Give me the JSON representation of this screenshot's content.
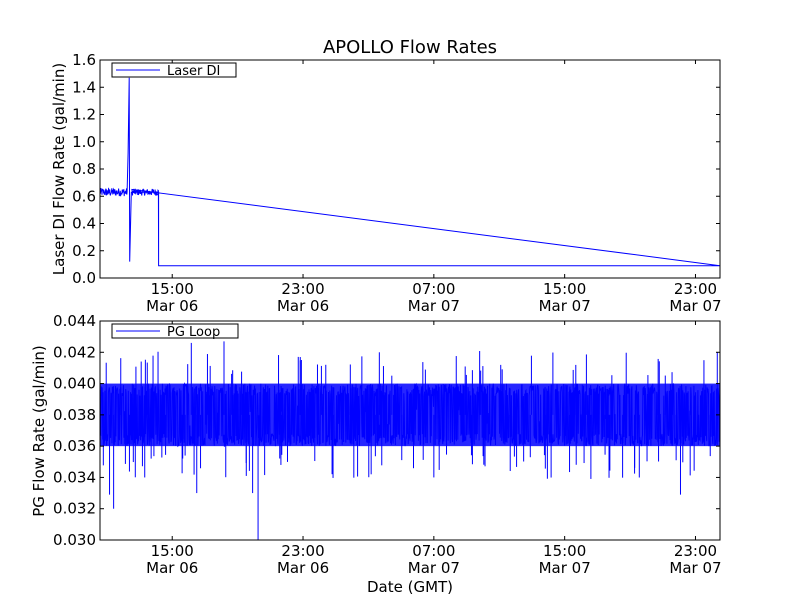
{
  "figure": {
    "title": "APOLLO Flow Rates",
    "xlabel": "Date (GMT)"
  },
  "chart_data": [
    {
      "type": "line",
      "ylabel": "Laser DI Flow Rate (gal/min)",
      "ylim": [
        0.0,
        1.6
      ],
      "yticks": [
        "0.0",
        "0.2",
        "0.4",
        "0.6",
        "0.8",
        "1.0",
        "1.2",
        "1.4",
        "1.6"
      ],
      "xlim": [
        "Mar 06 10:35",
        "Mar 08 00:30"
      ],
      "xticks": [
        {
          "time": "15:00",
          "date": "Mar 06"
        },
        {
          "time": "23:00",
          "date": "Mar 06"
        },
        {
          "time": "07:00",
          "date": "Mar 07"
        },
        {
          "time": "15:00",
          "date": "Mar 07"
        },
        {
          "time": "23:00",
          "date": "Mar 07"
        }
      ],
      "legend": {
        "label": "Laser DI",
        "position": "top-left"
      },
      "grid": false,
      "color": "#0000ff",
      "series": [
        {
          "name": "Laser DI",
          "approx_points": [
            {
              "t": "Mar 06 10:35",
              "y": 0.63
            },
            {
              "t": "Mar 06 11:30",
              "y": 0.64
            },
            {
              "t": "Mar 06 12:20",
              "y": 0.62
            },
            {
              "t": "Mar 06 12:18",
              "y": 0.92
            },
            {
              "t": "Mar 06 12:22",
              "y": 1.47
            },
            {
              "t": "Mar 06 12:24",
              "y": 0.12
            },
            {
              "t": "Mar 06 12:30",
              "y": 0.63
            },
            {
              "t": "Mar 06 14:10",
              "y": 0.63
            },
            {
              "t": "Mar 06 14:10",
              "y": 0.09
            },
            {
              "t": "Mar 08 00:30",
              "y": 0.09
            }
          ]
        }
      ]
    },
    {
      "type": "line",
      "ylabel": "PG Flow Rate (gal/min)",
      "ylim": [
        0.03,
        0.044
      ],
      "yticks": [
        "0.030",
        "0.032",
        "0.034",
        "0.036",
        "0.038",
        "0.040",
        "0.042",
        "0.044"
      ],
      "xlim": [
        "Mar 06 10:35",
        "Mar 08 00:30"
      ],
      "xticks": [
        {
          "time": "15:00",
          "date": "Mar 06"
        },
        {
          "time": "23:00",
          "date": "Mar 06"
        },
        {
          "time": "07:00",
          "date": "Mar 07"
        },
        {
          "time": "15:00",
          "date": "Mar 07"
        },
        {
          "time": "23:00",
          "date": "Mar 07"
        }
      ],
      "legend": {
        "label": "PG Loop",
        "position": "top-left"
      },
      "grid": false,
      "color": "#0000ff",
      "series": [
        {
          "name": "PG Loop",
          "description_values": {
            "typical_low": 0.036,
            "typical_high": 0.04,
            "mean": 0.038
          },
          "approx_spikes": [
            {
              "t": "Mar 06 11:10",
              "y": 0.0329
            },
            {
              "t": "Mar 06 11:25",
              "y": 0.032
            },
            {
              "t": "Mar 06 16:10",
              "y": 0.0426
            },
            {
              "t": "Mar 06 16:30",
              "y": 0.033
            },
            {
              "t": "Mar 06 18:10",
              "y": 0.0427
            },
            {
              "t": "Mar 06 19:55",
              "y": 0.033
            },
            {
              "t": "Mar 06 20:15",
              "y": 0.03
            },
            {
              "t": "Mar 07 03:10",
              "y": 0.0342
            },
            {
              "t": "Mar 07 03:40",
              "y": 0.042
            },
            {
              "t": "Mar 07 07:00",
              "y": 0.034
            },
            {
              "t": "Mar 07 22:05",
              "y": 0.0329
            },
            {
              "t": "Mar 08 00:20",
              "y": 0.042
            }
          ]
        }
      ]
    }
  ]
}
